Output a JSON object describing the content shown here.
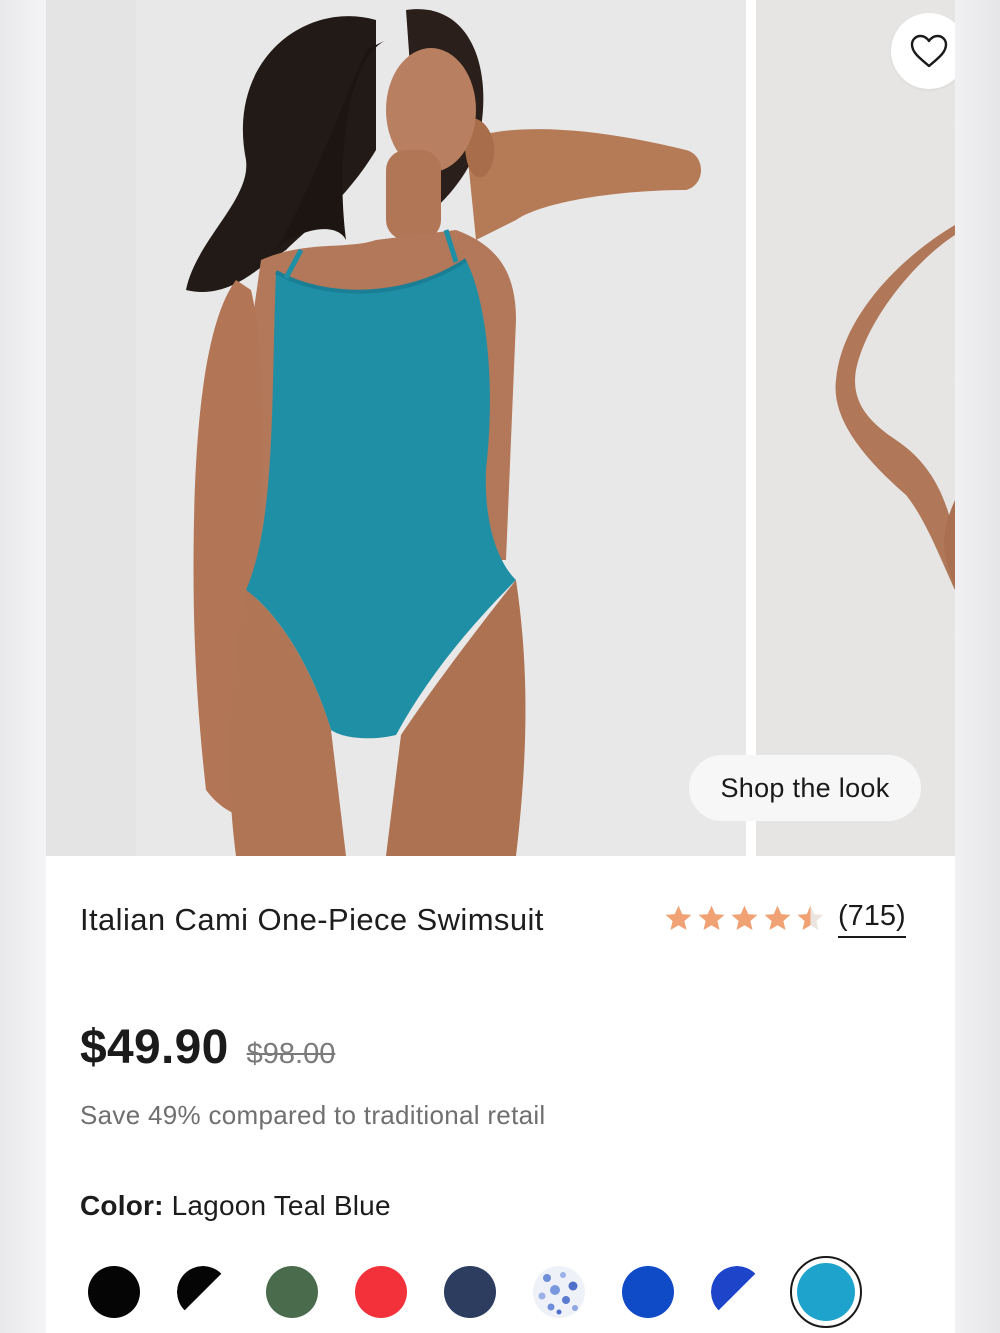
{
  "gallery": {
    "shop_the_look_label": "Shop the look",
    "favorite_icon": "heart-outline-icon"
  },
  "product": {
    "title": "Italian Cami One-Piece Swimsuit",
    "rating": 4.5,
    "rating_count": "(715)",
    "price": "$49.90",
    "compare_price": "$98.00",
    "savings_text": "Save 49% compared to traditional retail",
    "color_label": "Color:",
    "color_value": "Lagoon Teal Blue"
  },
  "colors": {
    "accent_star": "#f0a275",
    "star_empty": "#e8e2dc",
    "swimsuit_teal": "#1f8fa6"
  },
  "swatches": [
    {
      "name": "black",
      "fill": "#050505",
      "style": "solid",
      "selected": false
    },
    {
      "name": "black-white",
      "fill": "#050505",
      "style": "half",
      "selected": false
    },
    {
      "name": "green",
      "fill": "#4a6b4c",
      "style": "solid",
      "selected": false
    },
    {
      "name": "red",
      "fill": "#f3313a",
      "style": "solid",
      "selected": false
    },
    {
      "name": "navy",
      "fill": "#2d3d5f",
      "style": "solid",
      "selected": false
    },
    {
      "name": "blue-floral",
      "fill": "#6d8ed8",
      "style": "pattern",
      "selected": false
    },
    {
      "name": "royal-blue",
      "fill": "#0f4bc6",
      "style": "solid",
      "selected": false
    },
    {
      "name": "blue-white",
      "fill": "#1e44c9",
      "style": "half",
      "selected": false
    },
    {
      "name": "lagoon-teal-blue",
      "fill": "#1ea4cc",
      "style": "solid",
      "selected": true
    }
  ]
}
